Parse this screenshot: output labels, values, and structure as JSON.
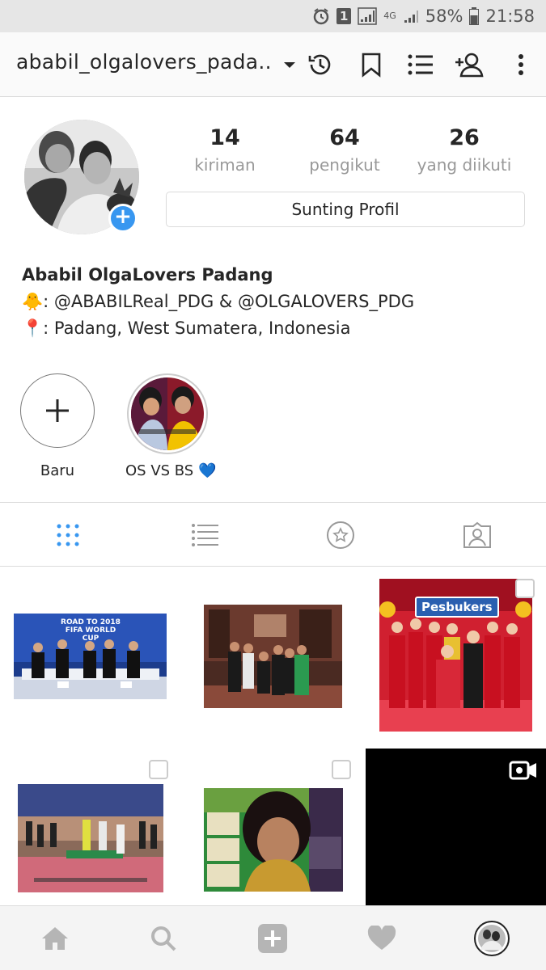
{
  "status_bar": {
    "sim_badge": "1",
    "network": "4G",
    "battery": "58%",
    "time": "21:58"
  },
  "header": {
    "username": "ababil_olgalovers_pada..",
    "icons": [
      "chevron-down-icon",
      "history-icon",
      "bookmark-icon",
      "discover-list-icon",
      "add-person-icon",
      "more-icon"
    ]
  },
  "profile": {
    "stats": [
      {
        "value": "14",
        "label": "kiriman"
      },
      {
        "value": "64",
        "label": "pengikut"
      },
      {
        "value": "26",
        "label": "yang diikuti"
      }
    ],
    "edit_button": "Sunting Profil",
    "name": "Ababil OlgaLovers Padang",
    "bio_line_1_emoji": "🐥",
    "bio_line_1": ": @ABABILReal_PDG & @OLGALOVERS_PDG",
    "bio_line_2_emoji": "📍",
    "bio_line_2": ": Padang,  West Sumatera, Indonesia"
  },
  "highlights": [
    {
      "label": "Baru"
    },
    {
      "label": "OS VS BS 💙"
    }
  ],
  "tabs": [
    "grid-icon",
    "list-icon",
    "star-icon",
    "tagged-icon"
  ],
  "posts": {
    "pesbukers_label": "Pesbukers",
    "worldcup_label": "ROAD TO 2018 FIFA WORLD CUP"
  },
  "colors": {
    "accent": "#3897f0",
    "border": "#dbdbdb",
    "muted_text": "#999999"
  }
}
